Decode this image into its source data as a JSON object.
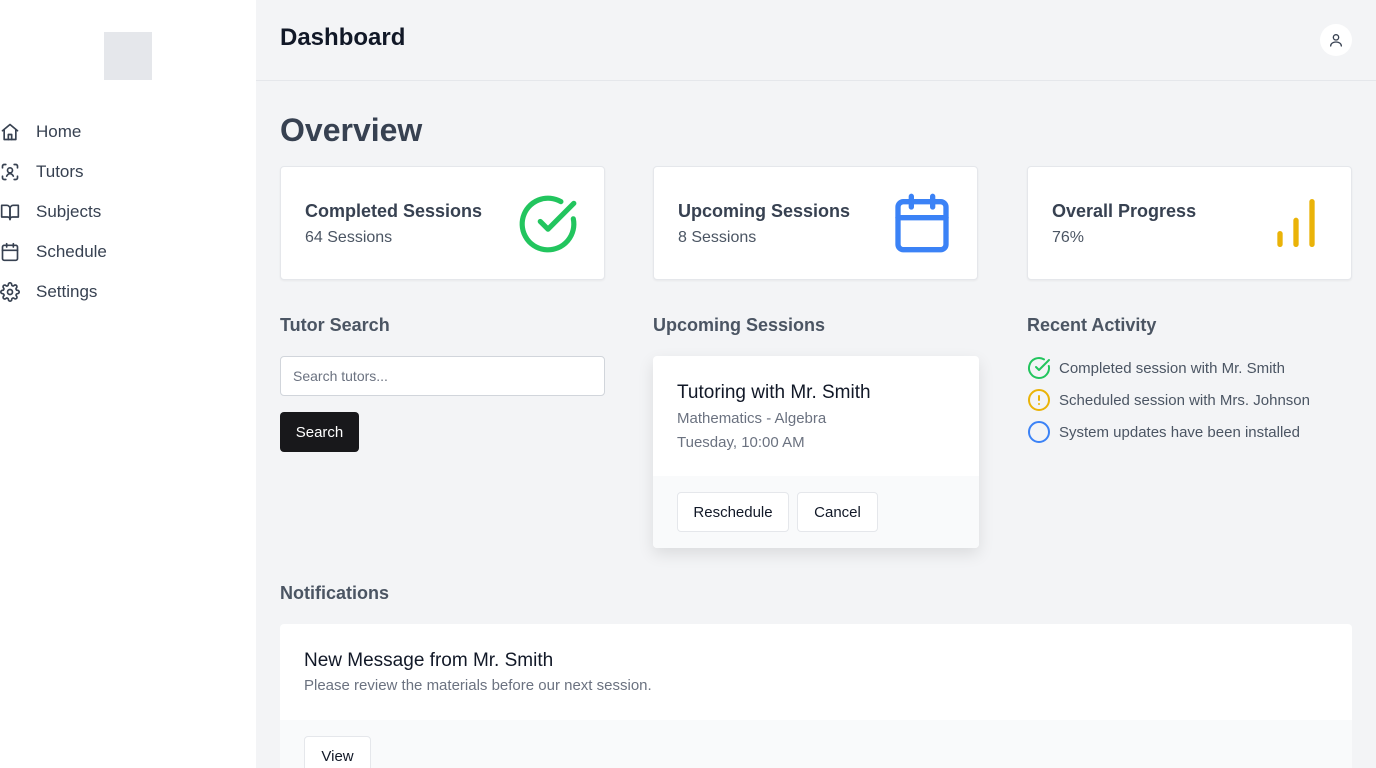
{
  "sidebar": {
    "items": [
      {
        "label": "Home",
        "icon": "home-icon"
      },
      {
        "label": "Tutors",
        "icon": "scan-face-icon"
      },
      {
        "label": "Subjects",
        "icon": "book-open-icon"
      },
      {
        "label": "Schedule",
        "icon": "calendar-icon"
      },
      {
        "label": "Settings",
        "icon": "gear-icon"
      }
    ]
  },
  "header": {
    "title": "Dashboard",
    "avatar_icon": "user-icon"
  },
  "overview": {
    "title": "Overview",
    "stats": [
      {
        "title": "Completed Sessions",
        "value": "64 Sessions",
        "icon": "check-circle-icon",
        "color": "#22c55e"
      },
      {
        "title": "Upcoming Sessions",
        "value": "8 Sessions",
        "icon": "calendar-icon",
        "color": "#3b82f6"
      },
      {
        "title": "Overall Progress",
        "value": "76%",
        "icon": "bar-chart-icon",
        "color": "#eab308"
      }
    ]
  },
  "tutor_search": {
    "heading": "Tutor Search",
    "placeholder": "Search tutors...",
    "value": "",
    "button": "Search"
  },
  "upcoming": {
    "heading": "Upcoming Sessions",
    "card": {
      "title": "Tutoring with Mr. Smith",
      "subject": "Mathematics - Algebra",
      "time": "Tuesday, 10:00 AM",
      "reschedule": "Reschedule",
      "cancel": "Cancel"
    }
  },
  "activity": {
    "heading": "Recent Activity",
    "items": [
      {
        "text": "Completed session with Mr. Smith",
        "icon": "check-circle-icon",
        "color": "#22c55e"
      },
      {
        "text": "Scheduled session with Mrs. Johnson",
        "icon": "alert-circle-icon",
        "color": "#eab308"
      },
      {
        "text": "System updates have been installed",
        "icon": "circle-icon",
        "color": "#3b82f6"
      }
    ]
  },
  "notifications": {
    "heading": "Notifications",
    "items": [
      {
        "title": "New Message from Mr. Smith",
        "body": "Please review the materials before our next session.",
        "action": "View"
      }
    ]
  }
}
